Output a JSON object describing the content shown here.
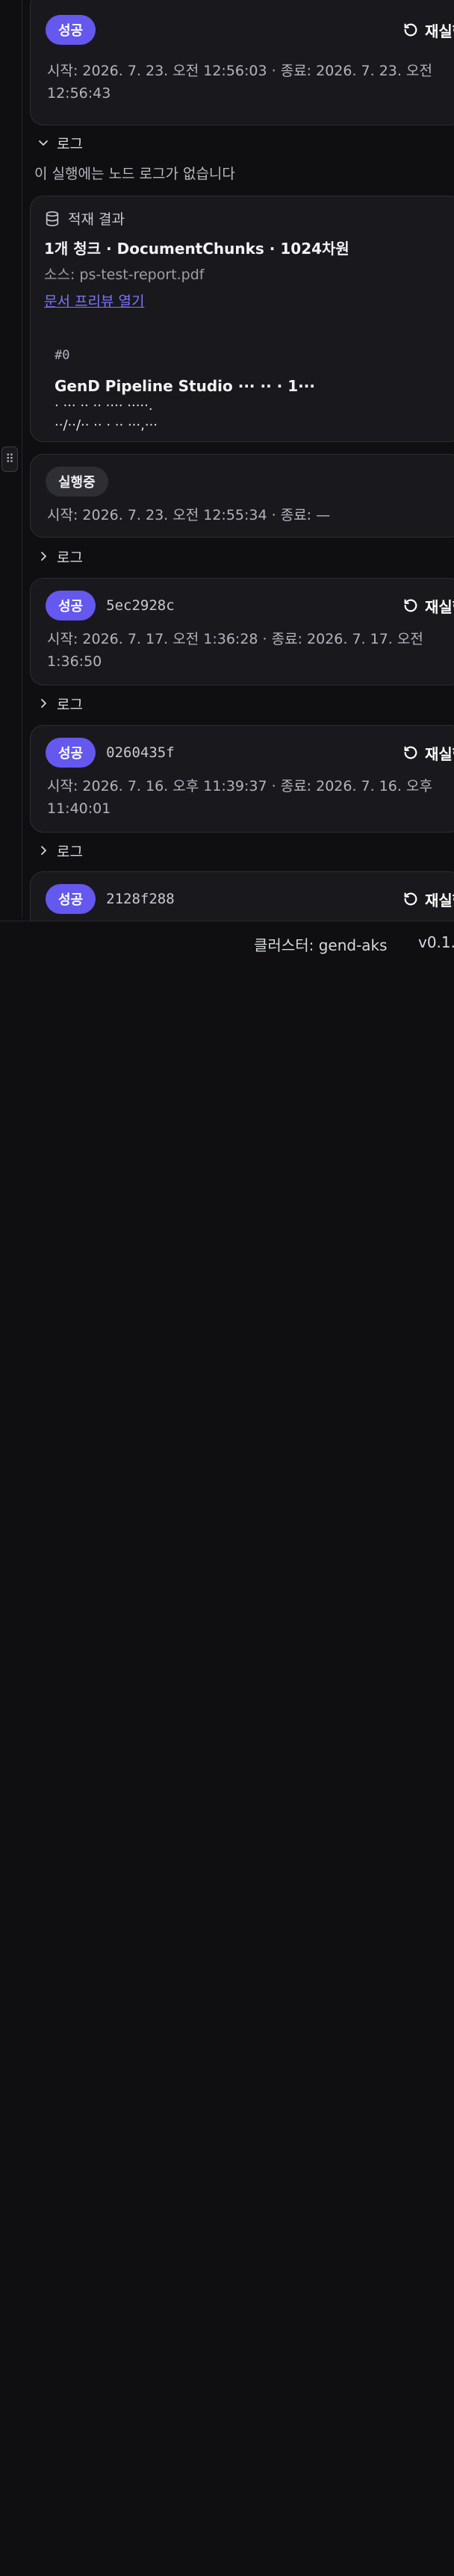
{
  "runs": [
    {
      "status": "성공",
      "rerun_label": "재실행",
      "times": "시작: 2026. 7. 23. 오전 12:56:03 · 종료: 2026. 7. 23. 오전 12:56:43",
      "log_label": "로그",
      "no_logs": "이 실행에는 노드 로그가 없습니다",
      "result": {
        "title": "적재 결과",
        "chunk_summary": "1개 청크 · DocumentChunks · 1024차원",
        "source": "소스: ps-test-report.pdf",
        "preview_link": "문서 프리뷰 열기",
        "chunk_index": "#0",
        "chunk_line1": "GenD Pipeline Studio ··· ·· · 1···",
        "chunk_line2": "· ··· ·· ·· ···· ·····.",
        "chunk_line3": "··/··/·· ·· · ·· ···,···"
      }
    },
    {
      "status": "실행중",
      "times": "시작: 2026. 7. 23. 오전 12:55:34 · 종료: —",
      "log_label": "로그"
    },
    {
      "status": "성공",
      "run_id": "5ec2928c",
      "rerun_label": "재실행",
      "times": "시작: 2026. 7. 17. 오전 1:36:28 · 종료: 2026. 7. 17. 오전 1:36:50",
      "log_label": "로그"
    },
    {
      "status": "성공",
      "run_id": "0260435f",
      "rerun_label": "재실행",
      "times": "시작: 2026. 7. 16. 오후 11:39:37 · 종료: 2026. 7. 16. 오후 11:40:01",
      "log_label": "로그"
    },
    {
      "status": "성공",
      "run_id": "2128f288",
      "rerun_label": "재실행"
    }
  ],
  "footer": {
    "cluster": "클러스터: gend-aks",
    "version": "v0.1."
  },
  "colors": {
    "background": "#0f0f12",
    "card": "#19191d",
    "success_badge": "#6458ee",
    "running_badge": "#2e2e35",
    "link": "#7b73ff"
  }
}
